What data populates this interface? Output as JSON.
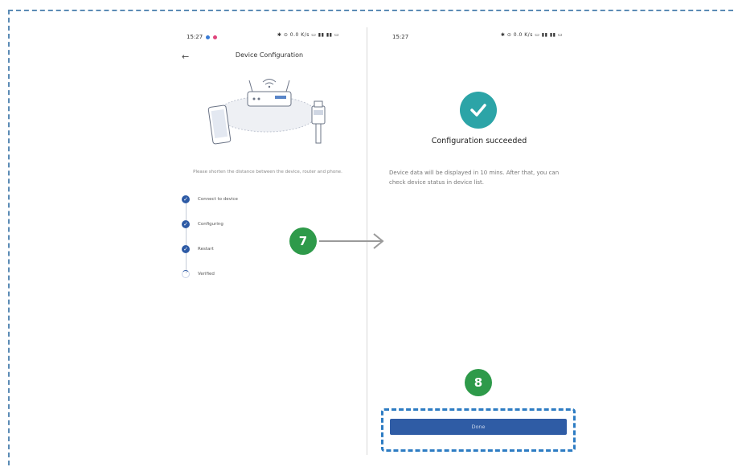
{
  "left_phone": {
    "status_time": "15:27",
    "status_icons": "✱ ⊙ 0.0 K/s ▭ ▮▮ ▮▮ ▭",
    "back_icon": "back-arrow-icon",
    "title": "Device Configuration",
    "hint": "Please shorten the distance between the device, router and phone.",
    "steps": [
      {
        "label": "Connect to device",
        "state": "done"
      },
      {
        "label": "Configuring",
        "state": "done"
      },
      {
        "label": "Restart",
        "state": "done"
      },
      {
        "label": "Verified",
        "state": "in-progress"
      }
    ]
  },
  "right_phone": {
    "status_time": "15:27",
    "status_icons": "✱ ⊙ 0.0 K/s ▭ ▮▮ ▮▮ ▭",
    "success_title": "Configuration succeeded",
    "success_desc": "Device data will be displayed in 10 mins. After that, you can check device status in device list.",
    "done_label": "Done"
  },
  "annotations": {
    "step7": "7",
    "step8": "8"
  },
  "colors": {
    "accent_blue": "#2f5ca5",
    "success_teal": "#2ca4a7",
    "badge_green": "#2e9a4a",
    "highlight_border": "#2d7cc3"
  }
}
